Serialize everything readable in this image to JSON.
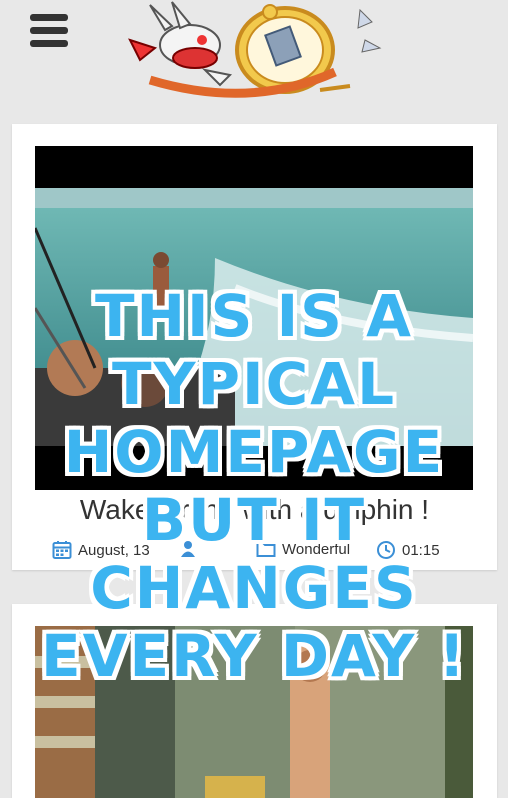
{
  "header": {
    "menu_icon": "hamburger-menu-icon",
    "logo": "rabbit-and-clock-logo"
  },
  "articles": [
    {
      "title": "Wakesurfing with a dolphin !",
      "date": "August, 13",
      "category": "Wonderful",
      "duration": "01:15",
      "author_icon": "user-icon"
    },
    {
      "title": "",
      "thumbnail": "gym-video-thumbnail"
    }
  ],
  "overlay": {
    "lines": [
      "THIS IS A",
      "TYPICAL",
      "HOMEPAGE",
      "BUT IT",
      "CHANGES",
      "EVERY DAY !"
    ]
  },
  "colors": {
    "accent": "#3b8fd6",
    "overlay_text": "#3cb4f0",
    "overlay_outline": "#ffffff",
    "page_bg": "#e8e8e8"
  }
}
